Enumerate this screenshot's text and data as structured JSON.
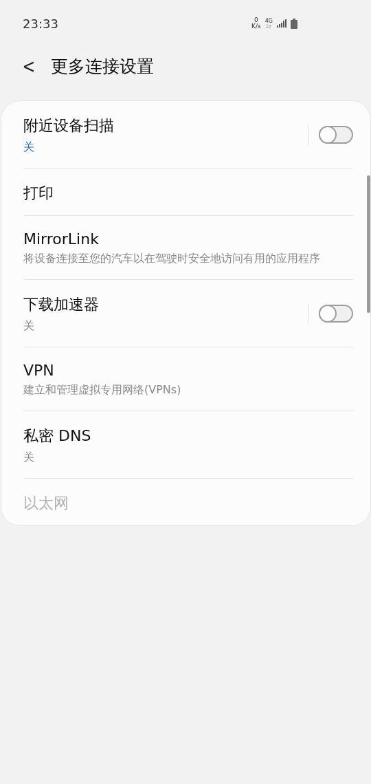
{
  "status_bar": {
    "time": "23:33",
    "net_speed_value": "0",
    "net_speed_unit": "K/s",
    "network_type": "4G"
  },
  "header": {
    "back_icon": "<",
    "title": "更多连接设置"
  },
  "items": [
    {
      "kind": "toggle",
      "title": "附近设备扫描",
      "summary": "关",
      "summary_accent": true,
      "on": false,
      "disabled": false
    },
    {
      "kind": "plain",
      "title": "打印",
      "disabled": false
    },
    {
      "kind": "plain",
      "title": "MirrorLink",
      "summary": "将设备连接至您的汽车以在驾驶时安全地访问有用的应用程序",
      "disabled": false
    },
    {
      "kind": "toggle",
      "title": "下载加速器",
      "summary": "关",
      "summary_accent": false,
      "on": false,
      "disabled": false
    },
    {
      "kind": "plain",
      "title": "VPN",
      "summary": "建立和管理虚拟专用网络(VPNs)",
      "disabled": false
    },
    {
      "kind": "plain",
      "title": "私密 DNS",
      "summary": "关",
      "disabled": false
    },
    {
      "kind": "plain",
      "title": "以太网",
      "disabled": true
    }
  ]
}
